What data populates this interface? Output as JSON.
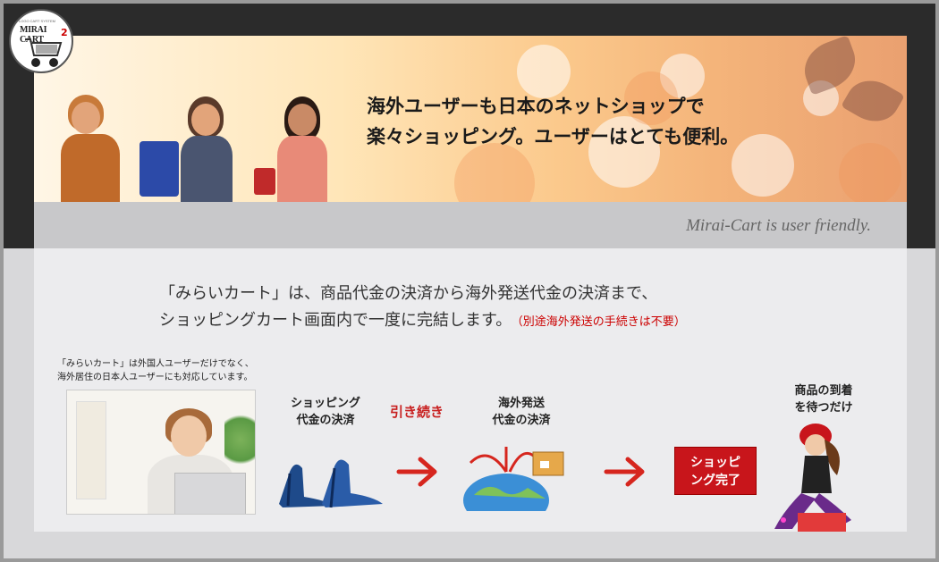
{
  "logo": {
    "text": "MIRAI CART",
    "sub": "LOGO CART SYSTEM",
    "mark": "2"
  },
  "banner": {
    "headline_line1": "海外ユーザーも日本のネットショップで",
    "headline_line2": "楽々ショッピング。ユーザーはとても便利。"
  },
  "tagline": "Mirai-Cart is user friendly.",
  "intro": {
    "line1": "「みらいカート」は、商品代金の決済から海外発送代金の決済まで、",
    "line2": "ショッピングカート画面内で一度に完結します。",
    "note": "（別途海外発送の手続きは不要）"
  },
  "small_note": {
    "line1": "「みらいカート」は外国人ユーザーだけでなく、",
    "line2": "海外居住の日本人ユーザーにも対応しています。"
  },
  "steps": {
    "payment_line1": "ショッピング",
    "payment_line2": "代金の決済",
    "continue": "引き続き",
    "shipping_line1": "海外発送",
    "shipping_line2": "代金の決済",
    "complete_line1": "ショッピ",
    "complete_line2": "ング完了",
    "wait_line1": "商品の到着",
    "wait_line2": "を待つだけ"
  },
  "colors": {
    "accent_red": "#c8151b",
    "arrow_red": "#d6261e",
    "frame": "#2b2b2b"
  }
}
